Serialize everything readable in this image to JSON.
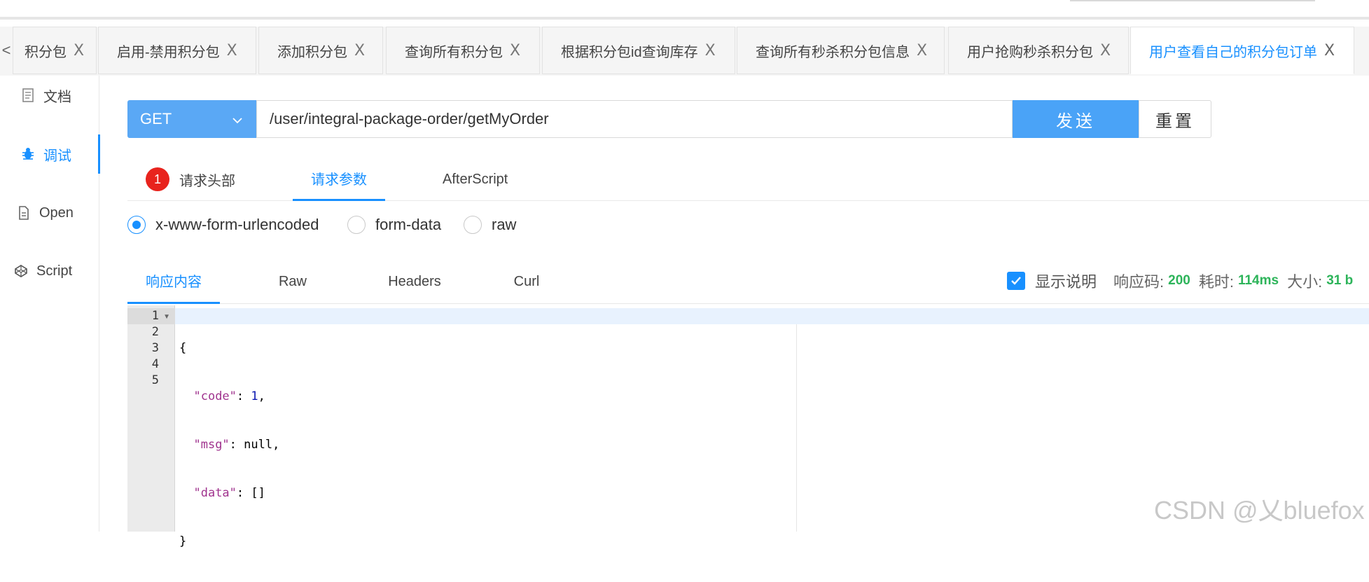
{
  "tabs": {
    "items": [
      {
        "label": "积分包"
      },
      {
        "label": "启用-禁用积分包"
      },
      {
        "label": "添加积分包"
      },
      {
        "label": "查询所有积分包"
      },
      {
        "label": "根据积分包id查询库存"
      },
      {
        "label": "查询所有秒杀积分包信息"
      },
      {
        "label": "用户抢购秒杀积分包"
      },
      {
        "label": "用户查看自己的积分包订单"
      }
    ],
    "active_index": 7,
    "prev_glyph": "<",
    "close_glyph": "X"
  },
  "sidebar": {
    "items": [
      {
        "label": "文档",
        "icon": "document-icon"
      },
      {
        "label": "调试",
        "icon": "bug-icon"
      },
      {
        "label": "Open",
        "icon": "file-icon"
      },
      {
        "label": "Script",
        "icon": "codepen-icon"
      }
    ],
    "active_index": 1
  },
  "request": {
    "method": "GET",
    "url": "/user/integral-package-order/getMyOrder",
    "send_label": "发送",
    "reset_label": "重置"
  },
  "request_tabs": {
    "headers_badge": "1",
    "headers_label": "请求头部",
    "params_label": "请求参数",
    "afterscript_label": "AfterScript"
  },
  "body_type": {
    "options": [
      "x-www-form-urlencoded",
      "form-data",
      "raw"
    ],
    "selected": "x-www-form-urlencoded"
  },
  "response_tabs": {
    "content_label": "响应内容",
    "raw_label": "Raw",
    "headers_label": "Headers",
    "curl_label": "Curl"
  },
  "response_meta": {
    "show_desc_label": "显示说明",
    "show_desc_checked": true,
    "status_label": "响应码:",
    "status_value": "200",
    "time_label": "耗时:",
    "time_value": "114ms",
    "size_label": "大小:",
    "size_value": "31 b"
  },
  "editor": {
    "line_numbers": [
      "1",
      "2",
      "3",
      "4",
      "5"
    ],
    "lines": [
      "{",
      "  \"code\": 1,",
      "  \"msg\": null,",
      "  \"data\": []",
      "}"
    ]
  },
  "watermark": "CSDN @乂bluefox",
  "colors": {
    "accent": "#1890ff",
    "method_bg": "#5aa8f5",
    "send_bg": "#4aa3f7",
    "badge": "#e8231d",
    "success": "#2db45a"
  }
}
